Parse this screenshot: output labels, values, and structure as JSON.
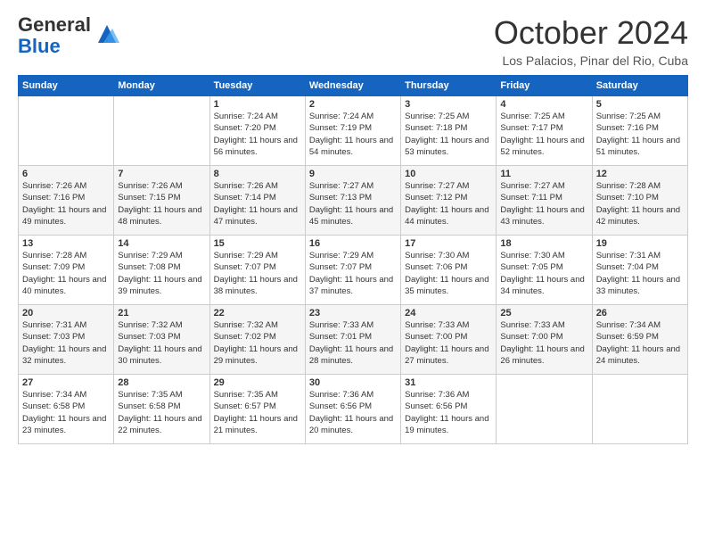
{
  "header": {
    "logo_general": "General",
    "logo_blue": "Blue",
    "title": "October 2024",
    "location": "Los Palacios, Pinar del Rio, Cuba"
  },
  "calendar": {
    "days_of_week": [
      "Sunday",
      "Monday",
      "Tuesday",
      "Wednesday",
      "Thursday",
      "Friday",
      "Saturday"
    ],
    "weeks": [
      [
        {
          "day": "",
          "sunrise": "",
          "sunset": "",
          "daylight": ""
        },
        {
          "day": "",
          "sunrise": "",
          "sunset": "",
          "daylight": ""
        },
        {
          "day": "1",
          "sunrise": "Sunrise: 7:24 AM",
          "sunset": "Sunset: 7:20 PM",
          "daylight": "Daylight: 11 hours and 56 minutes."
        },
        {
          "day": "2",
          "sunrise": "Sunrise: 7:24 AM",
          "sunset": "Sunset: 7:19 PM",
          "daylight": "Daylight: 11 hours and 54 minutes."
        },
        {
          "day": "3",
          "sunrise": "Sunrise: 7:25 AM",
          "sunset": "Sunset: 7:18 PM",
          "daylight": "Daylight: 11 hours and 53 minutes."
        },
        {
          "day": "4",
          "sunrise": "Sunrise: 7:25 AM",
          "sunset": "Sunset: 7:17 PM",
          "daylight": "Daylight: 11 hours and 52 minutes."
        },
        {
          "day": "5",
          "sunrise": "Sunrise: 7:25 AM",
          "sunset": "Sunset: 7:16 PM",
          "daylight": "Daylight: 11 hours and 51 minutes."
        }
      ],
      [
        {
          "day": "6",
          "sunrise": "Sunrise: 7:26 AM",
          "sunset": "Sunset: 7:16 PM",
          "daylight": "Daylight: 11 hours and 49 minutes."
        },
        {
          "day": "7",
          "sunrise": "Sunrise: 7:26 AM",
          "sunset": "Sunset: 7:15 PM",
          "daylight": "Daylight: 11 hours and 48 minutes."
        },
        {
          "day": "8",
          "sunrise": "Sunrise: 7:26 AM",
          "sunset": "Sunset: 7:14 PM",
          "daylight": "Daylight: 11 hours and 47 minutes."
        },
        {
          "day": "9",
          "sunrise": "Sunrise: 7:27 AM",
          "sunset": "Sunset: 7:13 PM",
          "daylight": "Daylight: 11 hours and 45 minutes."
        },
        {
          "day": "10",
          "sunrise": "Sunrise: 7:27 AM",
          "sunset": "Sunset: 7:12 PM",
          "daylight": "Daylight: 11 hours and 44 minutes."
        },
        {
          "day": "11",
          "sunrise": "Sunrise: 7:27 AM",
          "sunset": "Sunset: 7:11 PM",
          "daylight": "Daylight: 11 hours and 43 minutes."
        },
        {
          "day": "12",
          "sunrise": "Sunrise: 7:28 AM",
          "sunset": "Sunset: 7:10 PM",
          "daylight": "Daylight: 11 hours and 42 minutes."
        }
      ],
      [
        {
          "day": "13",
          "sunrise": "Sunrise: 7:28 AM",
          "sunset": "Sunset: 7:09 PM",
          "daylight": "Daylight: 11 hours and 40 minutes."
        },
        {
          "day": "14",
          "sunrise": "Sunrise: 7:29 AM",
          "sunset": "Sunset: 7:08 PM",
          "daylight": "Daylight: 11 hours and 39 minutes."
        },
        {
          "day": "15",
          "sunrise": "Sunrise: 7:29 AM",
          "sunset": "Sunset: 7:07 PM",
          "daylight": "Daylight: 11 hours and 38 minutes."
        },
        {
          "day": "16",
          "sunrise": "Sunrise: 7:29 AM",
          "sunset": "Sunset: 7:07 PM",
          "daylight": "Daylight: 11 hours and 37 minutes."
        },
        {
          "day": "17",
          "sunrise": "Sunrise: 7:30 AM",
          "sunset": "Sunset: 7:06 PM",
          "daylight": "Daylight: 11 hours and 35 minutes."
        },
        {
          "day": "18",
          "sunrise": "Sunrise: 7:30 AM",
          "sunset": "Sunset: 7:05 PM",
          "daylight": "Daylight: 11 hours and 34 minutes."
        },
        {
          "day": "19",
          "sunrise": "Sunrise: 7:31 AM",
          "sunset": "Sunset: 7:04 PM",
          "daylight": "Daylight: 11 hours and 33 minutes."
        }
      ],
      [
        {
          "day": "20",
          "sunrise": "Sunrise: 7:31 AM",
          "sunset": "Sunset: 7:03 PM",
          "daylight": "Daylight: 11 hours and 32 minutes."
        },
        {
          "day": "21",
          "sunrise": "Sunrise: 7:32 AM",
          "sunset": "Sunset: 7:03 PM",
          "daylight": "Daylight: 11 hours and 30 minutes."
        },
        {
          "day": "22",
          "sunrise": "Sunrise: 7:32 AM",
          "sunset": "Sunset: 7:02 PM",
          "daylight": "Daylight: 11 hours and 29 minutes."
        },
        {
          "day": "23",
          "sunrise": "Sunrise: 7:33 AM",
          "sunset": "Sunset: 7:01 PM",
          "daylight": "Daylight: 11 hours and 28 minutes."
        },
        {
          "day": "24",
          "sunrise": "Sunrise: 7:33 AM",
          "sunset": "Sunset: 7:00 PM",
          "daylight": "Daylight: 11 hours and 27 minutes."
        },
        {
          "day": "25",
          "sunrise": "Sunrise: 7:33 AM",
          "sunset": "Sunset: 7:00 PM",
          "daylight": "Daylight: 11 hours and 26 minutes."
        },
        {
          "day": "26",
          "sunrise": "Sunrise: 7:34 AM",
          "sunset": "Sunset: 6:59 PM",
          "daylight": "Daylight: 11 hours and 24 minutes."
        }
      ],
      [
        {
          "day": "27",
          "sunrise": "Sunrise: 7:34 AM",
          "sunset": "Sunset: 6:58 PM",
          "daylight": "Daylight: 11 hours and 23 minutes."
        },
        {
          "day": "28",
          "sunrise": "Sunrise: 7:35 AM",
          "sunset": "Sunset: 6:58 PM",
          "daylight": "Daylight: 11 hours and 22 minutes."
        },
        {
          "day": "29",
          "sunrise": "Sunrise: 7:35 AM",
          "sunset": "Sunset: 6:57 PM",
          "daylight": "Daylight: 11 hours and 21 minutes."
        },
        {
          "day": "30",
          "sunrise": "Sunrise: 7:36 AM",
          "sunset": "Sunset: 6:56 PM",
          "daylight": "Daylight: 11 hours and 20 minutes."
        },
        {
          "day": "31",
          "sunrise": "Sunrise: 7:36 AM",
          "sunset": "Sunset: 6:56 PM",
          "daylight": "Daylight: 11 hours and 19 minutes."
        },
        {
          "day": "",
          "sunrise": "",
          "sunset": "",
          "daylight": ""
        },
        {
          "day": "",
          "sunrise": "",
          "sunset": "",
          "daylight": ""
        }
      ]
    ]
  }
}
